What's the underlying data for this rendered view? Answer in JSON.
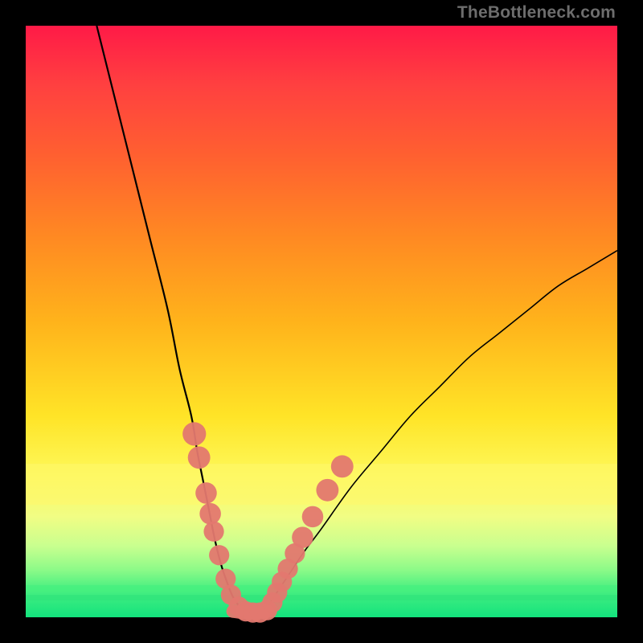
{
  "watermark": "TheBottleneck.com",
  "colors": {
    "frame": "#000000",
    "curve": "#000000",
    "marker_fill": "#e3786f",
    "marker_stroke": "#cf5a55"
  },
  "chart_data": {
    "type": "line",
    "title": "",
    "xlabel": "",
    "ylabel": "",
    "xlim": [
      0,
      100
    ],
    "ylim": [
      0,
      100
    ],
    "series": [
      {
        "name": "left-curve",
        "x": [
          12,
          15,
          18,
          21,
          24,
          26,
          28,
          29,
          30,
          31,
          32,
          33,
          34,
          35,
          36,
          37
        ],
        "y": [
          100,
          88,
          76,
          64,
          52,
          42,
          34,
          28,
          23,
          18,
          13,
          9,
          6,
          3.5,
          2,
          1
        ]
      },
      {
        "name": "right-curve",
        "x": [
          40,
          41,
          42,
          43,
          45,
          47,
          50,
          55,
          60,
          65,
          70,
          75,
          80,
          85,
          90,
          95,
          100
        ],
        "y": [
          1,
          2,
          3.5,
          5,
          8,
          11,
          15,
          22,
          28,
          34,
          39,
          44,
          48,
          52,
          56,
          59,
          62
        ]
      },
      {
        "name": "flat-bottom",
        "x": [
          35,
          36.5,
          38,
          39,
          40,
          41
        ],
        "y": [
          1,
          0.8,
          0.7,
          0.7,
          0.8,
          1
        ]
      }
    ],
    "markers": [
      {
        "x": 28.5,
        "y": 31,
        "r": 1.6
      },
      {
        "x": 29.3,
        "y": 27,
        "r": 1.5
      },
      {
        "x": 30.5,
        "y": 21,
        "r": 1.4
      },
      {
        "x": 31.2,
        "y": 17.5,
        "r": 1.4
      },
      {
        "x": 31.8,
        "y": 14.5,
        "r": 1.3
      },
      {
        "x": 32.7,
        "y": 10.5,
        "r": 1.3
      },
      {
        "x": 33.8,
        "y": 6.5,
        "r": 1.3
      },
      {
        "x": 34.7,
        "y": 3.8,
        "r": 1.3
      },
      {
        "x": 36.0,
        "y": 1.8,
        "r": 1.3
      },
      {
        "x": 37.2,
        "y": 1.0,
        "r": 1.3
      },
      {
        "x": 38.4,
        "y": 0.8,
        "r": 1.3
      },
      {
        "x": 39.6,
        "y": 0.8,
        "r": 1.3
      },
      {
        "x": 40.8,
        "y": 1.2,
        "r": 1.3
      },
      {
        "x": 41.7,
        "y": 2.5,
        "r": 1.3
      },
      {
        "x": 42.5,
        "y": 4.2,
        "r": 1.3
      },
      {
        "x": 43.3,
        "y": 6.0,
        "r": 1.3
      },
      {
        "x": 44.3,
        "y": 8.2,
        "r": 1.3
      },
      {
        "x": 45.5,
        "y": 10.8,
        "r": 1.3
      },
      {
        "x": 46.8,
        "y": 13.5,
        "r": 1.4
      },
      {
        "x": 48.5,
        "y": 17.0,
        "r": 1.4
      },
      {
        "x": 51.0,
        "y": 21.5,
        "r": 1.5
      },
      {
        "x": 53.5,
        "y": 25.5,
        "r": 1.5
      }
    ]
  }
}
